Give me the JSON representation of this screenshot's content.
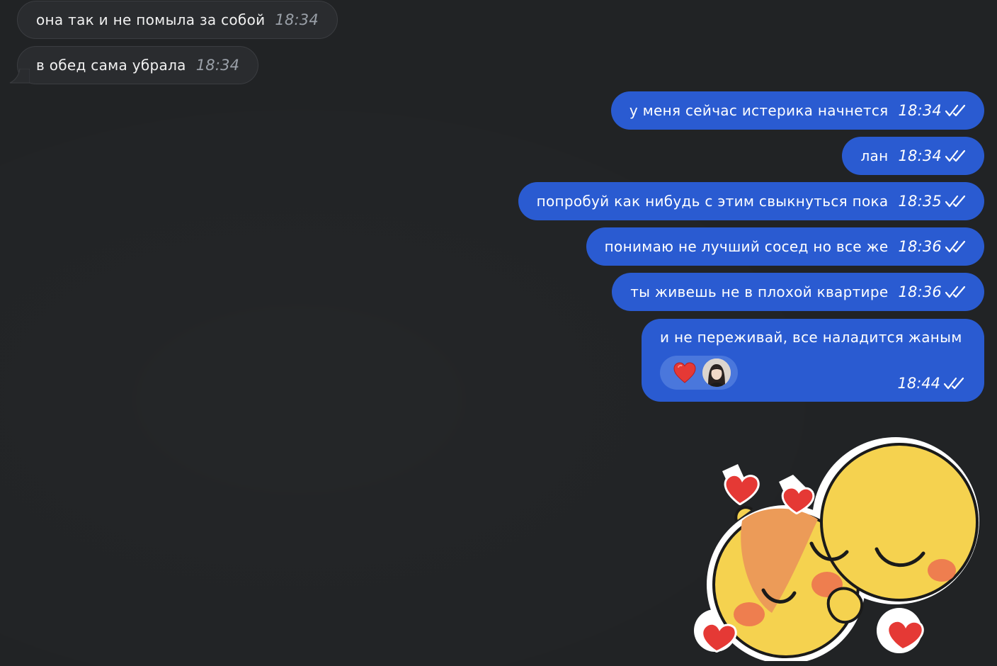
{
  "messages": [
    {
      "direction": "in",
      "text": "она так и не помыла за собой",
      "time": "18:34"
    },
    {
      "direction": "in",
      "text": "в обед сама убрала",
      "time": "18:34"
    },
    {
      "direction": "out",
      "text": "у меня сейчас истерика начнется",
      "time": "18:34",
      "status": "read"
    },
    {
      "direction": "out",
      "text": "лан",
      "time": "18:34",
      "status": "read"
    },
    {
      "direction": "out",
      "text": "попробуй как нибудь с этим свыкнуться пока",
      "time": "18:35",
      "status": "read"
    },
    {
      "direction": "out",
      "text": "понимаю не лучший сосед но все же",
      "time": "18:36",
      "status": "read"
    },
    {
      "direction": "out",
      "text": "ты живешь не в плохой квартире",
      "time": "18:36",
      "status": "read"
    },
    {
      "direction": "out",
      "text": "и не переживай, все наладится жаным",
      "time": "18:44",
      "status": "read",
      "reaction": {
        "emoji_icon": "red-heart-icon",
        "reactor": "avatar"
      }
    }
  ],
  "sticker": {
    "icon": "hugging-emoji-sticker"
  },
  "colors": {
    "background": "#212325",
    "incoming_bubble": "#2a2c2f",
    "outgoing_bubble": "#2a5bd1",
    "reaction_chip": "#4a77dc",
    "heart": "#e53935"
  }
}
